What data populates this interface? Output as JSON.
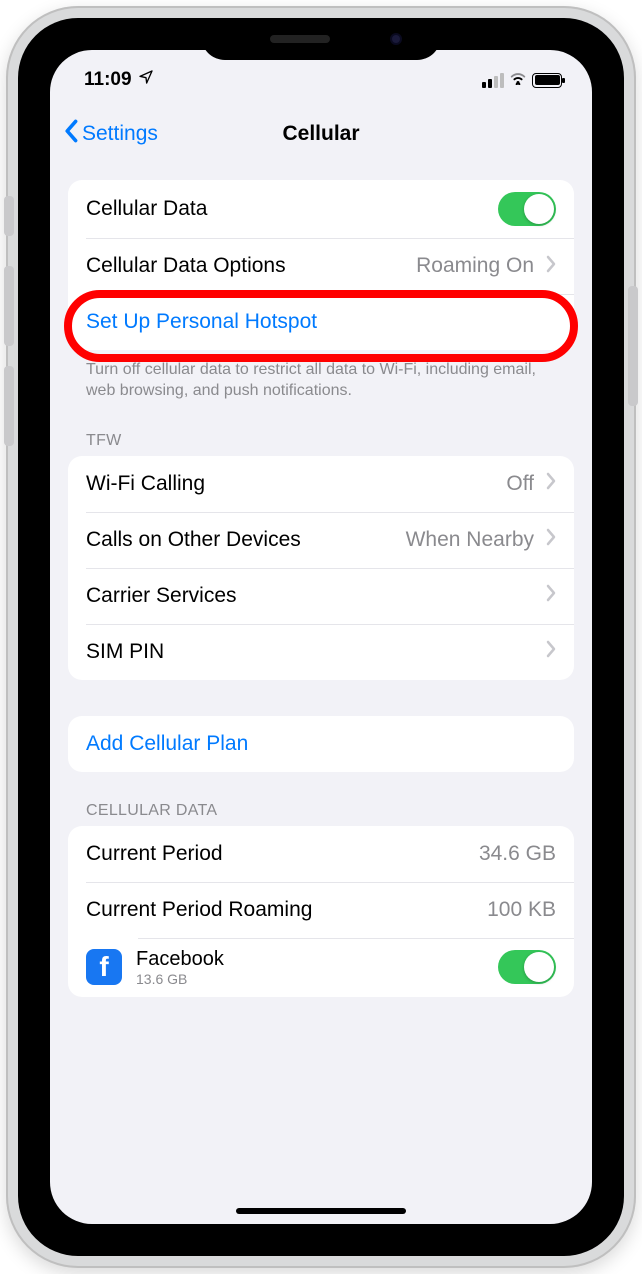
{
  "status": {
    "time": "11:09",
    "location_icon": "location-arrow"
  },
  "nav": {
    "back": "Settings",
    "title": "Cellular"
  },
  "group1": {
    "cellular_data": "Cellular Data",
    "cellular_data_options": "Cellular Data Options",
    "cellular_data_options_value": "Roaming On",
    "personal_hotspot": "Set Up Personal Hotspot"
  },
  "footer1": "Turn off cellular data to restrict all data to Wi-Fi, including email, web browsing, and push notifications.",
  "carrier_header": "TFW",
  "group2": {
    "wifi_calling": "Wi-Fi Calling",
    "wifi_calling_value": "Off",
    "other_devices": "Calls on Other Devices",
    "other_devices_value": "When Nearby",
    "carrier_services": "Carrier Services",
    "sim_pin": "SIM PIN"
  },
  "group3": {
    "add_plan": "Add Cellular Plan"
  },
  "usage_header": "CELLULAR DATA",
  "group4": {
    "current_period": "Current Period",
    "current_period_value": "34.6 GB",
    "roaming": "Current Period Roaming",
    "roaming_value": "100 KB"
  },
  "app": {
    "name": "Facebook",
    "sub": "13.6 GB",
    "glyph": "f"
  }
}
